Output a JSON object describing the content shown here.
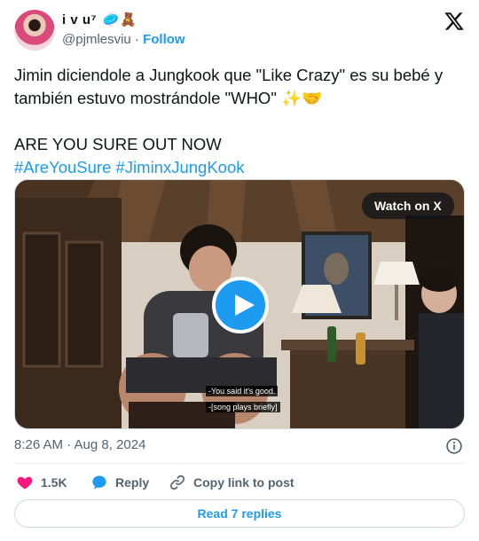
{
  "author": {
    "display_name": "i v u⁷",
    "name_emojis": "🥏🧸",
    "handle": "@pjmlesviu",
    "separator": "·",
    "follow_label": "Follow"
  },
  "tweet": {
    "line1": "Jimin diciendole a Jungkook que \"Like Crazy\" es su bebé y también estuvo mostrándole \"WHO\" ✨🤝",
    "line2": "ARE YOU SURE OUT NOW",
    "hashtags": [
      "#AreYouSure",
      "#JiminxJungKook"
    ]
  },
  "media": {
    "watch_label": "Watch on X",
    "subtitles": [
      "-You said it's good.",
      "-[song plays briefly]"
    ]
  },
  "meta": {
    "timestamp": "8:26 AM · Aug 8, 2024"
  },
  "actions": {
    "likes": "1.5K",
    "reply_label": "Reply",
    "copy_label": "Copy link to post",
    "read_replies_label": "Read 7 replies"
  },
  "colors": {
    "accent": "#1d9bf0",
    "like": "#f91880",
    "text": "#0f1419",
    "muted": "#536471"
  },
  "icons": [
    "avatar",
    "x-logo-icon",
    "play-icon",
    "info-icon",
    "heart-icon",
    "reply-bubble-icon",
    "link-icon"
  ]
}
